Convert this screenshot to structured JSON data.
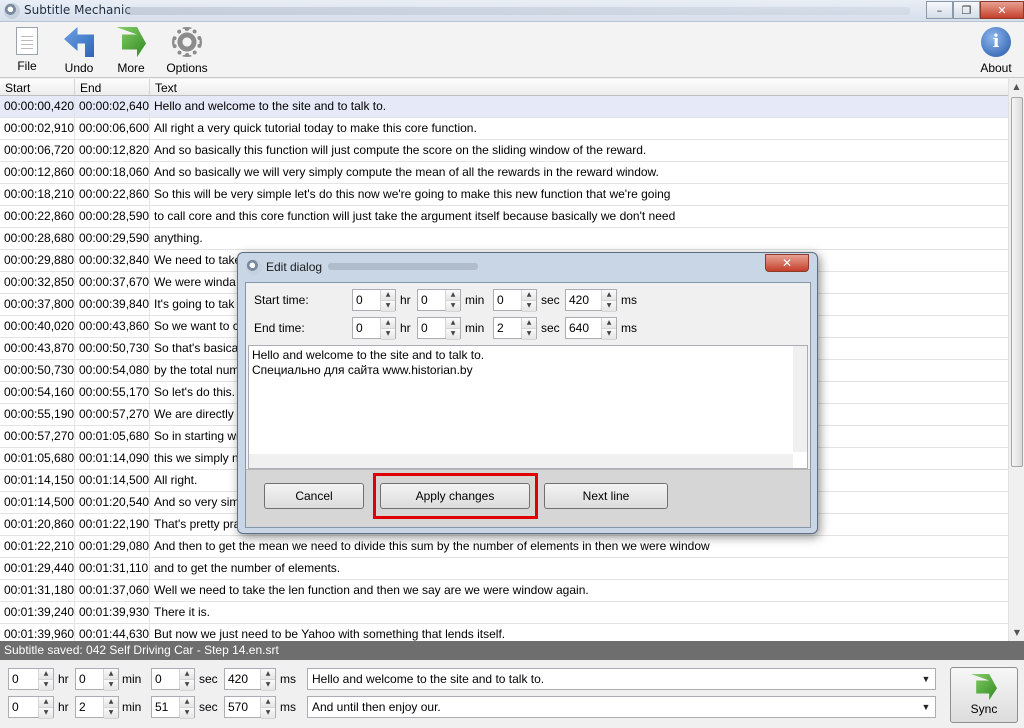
{
  "window": {
    "title": "Subtitle Mechanic",
    "controls": [
      "–",
      "❐",
      "✕"
    ]
  },
  "toolbar": {
    "file": "File",
    "undo": "Undo",
    "more": "More",
    "options": "Options",
    "about": "About"
  },
  "table": {
    "headers": [
      "Start",
      "End",
      "Text"
    ],
    "rows": [
      {
        "start": "00:00:00,420",
        "end": "00:00:02,640",
        "text": "Hello and welcome to the site and to talk to."
      },
      {
        "start": "00:00:02,910",
        "end": "00:00:06,600",
        "text": "All right a very quick tutorial today to make this core function."
      },
      {
        "start": "00:00:06,720",
        "end": "00:00:12,820",
        "text": "And so basically this function will just compute the score on the sliding window of the reward."
      },
      {
        "start": "00:00:12,860",
        "end": "00:00:18,060",
        "text": "And so basically we will very simply compute the mean of all the rewards in the reward window."
      },
      {
        "start": "00:00:18,210",
        "end": "00:00:22,860",
        "text": "So this will be very simple let's do this now we're going to make this new function that we're going"
      },
      {
        "start": "00:00:22,860",
        "end": "00:00:28,590",
        "text": "to call core and this core function will just take the argument itself because basically we don't need"
      },
      {
        "start": "00:00:28,680",
        "end": "00:00:29,590",
        "text": "anything."
      },
      {
        "start": "00:00:29,880",
        "end": "00:00:32,840",
        "text": "We need to take"
      },
      {
        "start": "00:00:32,850",
        "end": "00:00:37,670",
        "text": "We were winda"
      },
      {
        "start": "00:00:37,800",
        "end": "00:00:39,840",
        "text": "It's going to tak"
      },
      {
        "start": "00:00:40,020",
        "end": "00:00:43,860",
        "text": "So we want to c"
      },
      {
        "start": "00:00:43,870",
        "end": "00:00:50,730",
        "text": "So that's basical"
      },
      {
        "start": "00:00:50,730",
        "end": "00:00:54,080",
        "text": "by the total num"
      },
      {
        "start": "00:00:54,160",
        "end": "00:00:55,170",
        "text": "So let's do this."
      },
      {
        "start": "00:00:55,190",
        "end": "00:00:57,270",
        "text": "We are directly g"
      },
      {
        "start": "00:00:57,270",
        "end": "00:01:05,680",
        "text": "So in starting wi"
      },
      {
        "start": "00:01:05,680",
        "end": "00:01:14,090",
        "text": "this we simply n"
      },
      {
        "start": "00:01:14,150",
        "end": "00:01:14,500",
        "text": "All right."
      },
      {
        "start": "00:01:14,500",
        "end": "00:01:20,540",
        "text": "And so very sim"
      },
      {
        "start": "00:01:20,860",
        "end": "00:01:22,190",
        "text": "That's pretty pra"
      },
      {
        "start": "00:01:22,210",
        "end": "00:01:29,080",
        "text": "And then to get the mean we need to divide this sum by the number of elements in then we were window"
      },
      {
        "start": "00:01:29,440",
        "end": "00:01:31,110",
        "text": "and to get the number of elements."
      },
      {
        "start": "00:01:31,180",
        "end": "00:01:37,060",
        "text": "Well we need to take the len function and then we say are we were window again."
      },
      {
        "start": "00:01:39,240",
        "end": "00:01:39,930",
        "text": "There it is."
      },
      {
        "start": "00:01:39,960",
        "end": "00:01:44,630",
        "text": "But now we just need to be Yahoo with something that lends itself."
      }
    ]
  },
  "status": {
    "text": "Subtitle saved: 042 Self Driving Car - Step 14.en.srt"
  },
  "bottom": {
    "start": {
      "hr": "0",
      "min": "0",
      "sec": "0",
      "ms": "420"
    },
    "end": {
      "hr": "0",
      "min": "2",
      "sec": "51",
      "ms": "570"
    },
    "units": {
      "hr": "hr",
      "min": "min",
      "sec": "sec",
      "ms": "ms"
    },
    "line1": "Hello and welcome to the site and to talk to.",
    "line2": "And until then enjoy our.",
    "sync": "Sync"
  },
  "dialog": {
    "title": "Edit dialog",
    "close": "✕",
    "start_label": "Start time:",
    "end_label": "End time:",
    "start": {
      "hr": "0",
      "min": "0",
      "sec": "0",
      "ms": "420"
    },
    "end": {
      "hr": "0",
      "min": "0",
      "sec": "2",
      "ms": "640"
    },
    "text_line1": "Hello and welcome to the site and to talk to.",
    "text_line2": "Специально для сайта www.historian.by",
    "cancel": "Cancel",
    "apply": "Apply changes",
    "next": "Next line"
  },
  "colors": {
    "selected_row": "#e6e9f7",
    "status_bar": "#6e6e6e",
    "highlight": "#e00000"
  }
}
